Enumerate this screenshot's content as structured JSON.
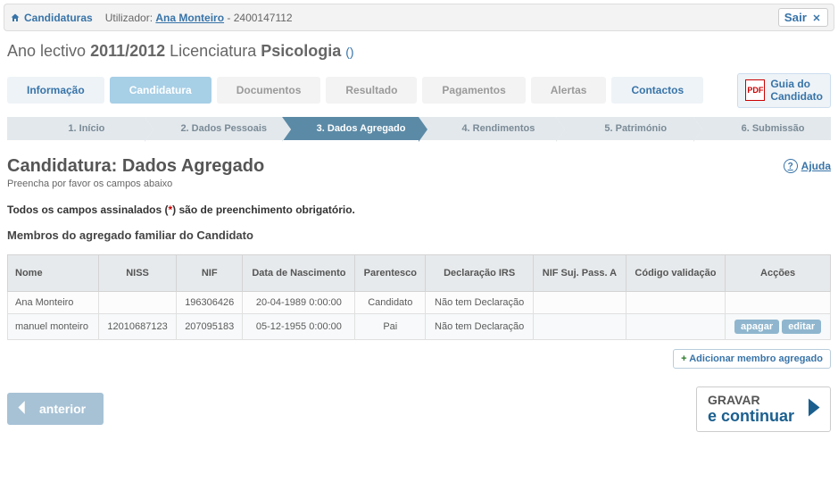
{
  "topbar": {
    "candidaturas": "Candidaturas",
    "user_label": "Utilizador:",
    "user_name": "Ana Monteiro",
    "user_id": "2400147112",
    "sair": "Sair"
  },
  "heading": {
    "prefix": "Ano lectivo ",
    "year": "2011/2012",
    "mid": " Licenciatura ",
    "course": "Psicologia",
    "paren": "()"
  },
  "tabs": {
    "informacao": "Informação",
    "candidatura": "Candidatura",
    "documentos": "Documentos",
    "resultado": "Resultado",
    "pagamentos": "Pagamentos",
    "alertas": "Alertas",
    "contactos": "Contactos",
    "guide_l1": "Guia do",
    "guide_l2": "Candidato"
  },
  "steps": {
    "s1": "1. Início",
    "s2": "2. Dados Pessoais",
    "s3": "3. Dados Agregado",
    "s4": "4. Rendimentos",
    "s5": "5. Património",
    "s6": "6. Submissão"
  },
  "page": {
    "title": "Candidatura: Dados Agregado",
    "sub": "Preencha por favor os campos abaixo",
    "help": "Ajuda",
    "mand_pre": "Todos os campos assinalados (",
    "mand_ast": "*",
    "mand_post": ") são de preenchimento obrigatório.",
    "section": "Membros do agregado familiar do Candidato"
  },
  "table": {
    "headers": {
      "nome": "Nome",
      "niss": "NISS",
      "nif": "NIF",
      "dn": "Data de Nascimento",
      "parent": "Parentesco",
      "irs": "Declaração IRS",
      "nifsuj": "NIF Suj. Pass. A",
      "codval": "Código validação",
      "acc": "Acções"
    },
    "rows": [
      {
        "nome": "Ana Monteiro",
        "niss": "",
        "nif": "196306426",
        "dn": "20-04-1989 0:00:00",
        "parent": "Candidato",
        "irs": "Não tem Declaração",
        "nifsuj": "",
        "codval": ""
      },
      {
        "nome": "manuel monteiro",
        "niss": "12010687123",
        "nif": "207095183",
        "dn": "05-12-1955 0:00:00",
        "parent": "Pai",
        "irs": "Não tem Declaração",
        "nifsuj": "",
        "codval": ""
      }
    ],
    "apagar": "apagar",
    "editar": "editar",
    "add": "Adicionar membro agregado"
  },
  "nav": {
    "prev": "anterior",
    "next_t1": "GRAVAR",
    "next_t2": "e continuar"
  }
}
